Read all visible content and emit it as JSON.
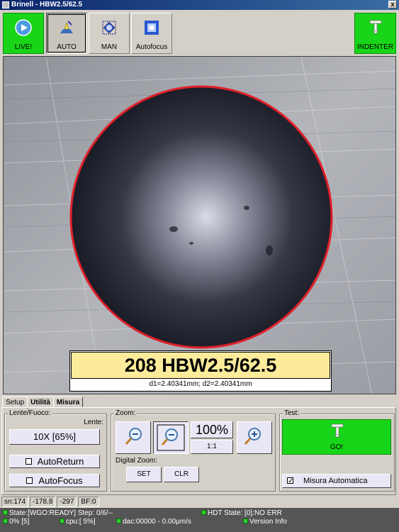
{
  "window": {
    "title": "Brinell - HBW2.5/62.5",
    "close_label": "x"
  },
  "toolbar": {
    "live_label": "LIVE!",
    "auto_label": "AUTO",
    "man_label": "MAN",
    "autofocus_label": "Autofocus",
    "indenter_label": "INDENTER"
  },
  "result": {
    "hardness": "208 HBW2.5/62.5",
    "diagonals": "d1=2.40341mm; d2=2.40341mm"
  },
  "tabs": [
    "Setup",
    "Utilità",
    "Misura"
  ],
  "lente": {
    "group_title": "Lente/Fuoco:",
    "lens_caption": "Lente:",
    "lens_value": "10X [65%]",
    "autoreturn_label": "AutoReturn",
    "autofocus_label": "AutoFocus"
  },
  "zoom": {
    "group_title": "Zoom:",
    "level": "100%",
    "one_to_one": "1:1",
    "digital_zoom_label": "Digital Zoom:",
    "set_label": "SET",
    "clr_label": "CLR"
  },
  "test": {
    "group_title": "Test:",
    "go_label": "GO!",
    "auto_measure_label": "Misura Automatica",
    "auto_measure_checked": true
  },
  "status_bar": {
    "sn": "sn:174",
    "x": "-178.8",
    "y": "-297",
    "bf": "BF:0"
  },
  "state_bar": {
    "state": "State:[WGO:READY] Step: 0/6/--",
    "hdt_state": "HDT State: [0]:NO ERR",
    "progress": "0% [5]",
    "cpu": "cpu:[ 5%]",
    "dac": "dac:00000 - 0.00µm/s",
    "version": "Version Info"
  },
  "colors": {
    "green_button": "#19d519",
    "result_background": "#fbeb9a",
    "indent_outline": "#e0202a",
    "status_ok": "#2dd02d"
  }
}
